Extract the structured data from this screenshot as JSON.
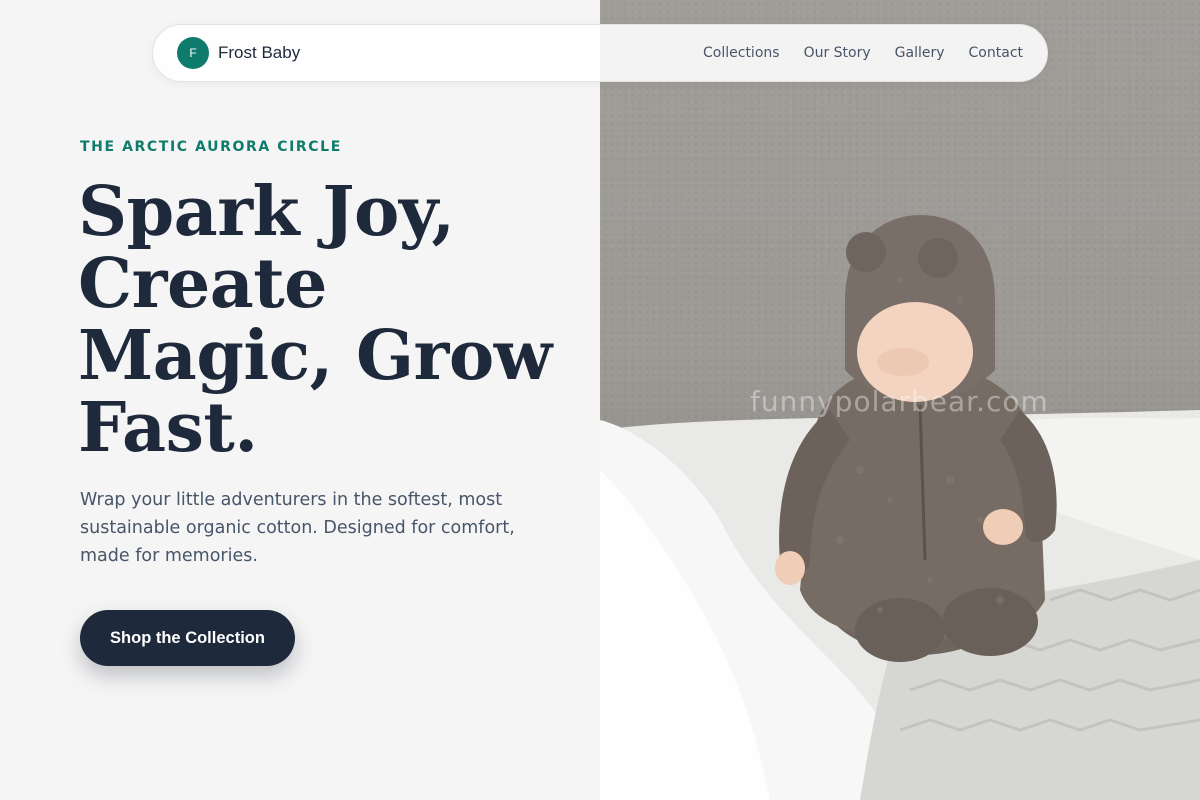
{
  "nav": {
    "logo_letter": "F",
    "brand_name": "Frost Baby",
    "links": [
      {
        "label": "Collections"
      },
      {
        "label": "Our Story"
      },
      {
        "label": "Gallery"
      },
      {
        "label": "Contact"
      }
    ]
  },
  "hero": {
    "eyebrow": "THE ARCTIC AURORA CIRCLE",
    "headline_lines": [
      "Spark Joy,",
      "Create",
      "Magic, Grow",
      "Fast."
    ],
    "subcopy": "Wrap your little adventurers in the softest, most sustainable organic cotton. Designed for comfort, made for memories.",
    "cta_label": "Shop the Collection"
  },
  "photo": {
    "watermark": "funnypolarbear.com",
    "subject": "baby-in-bear-suit"
  },
  "colors": {
    "accent": "#0f7b6c",
    "navy": "#1e293b",
    "background": "#f5f5f5"
  }
}
